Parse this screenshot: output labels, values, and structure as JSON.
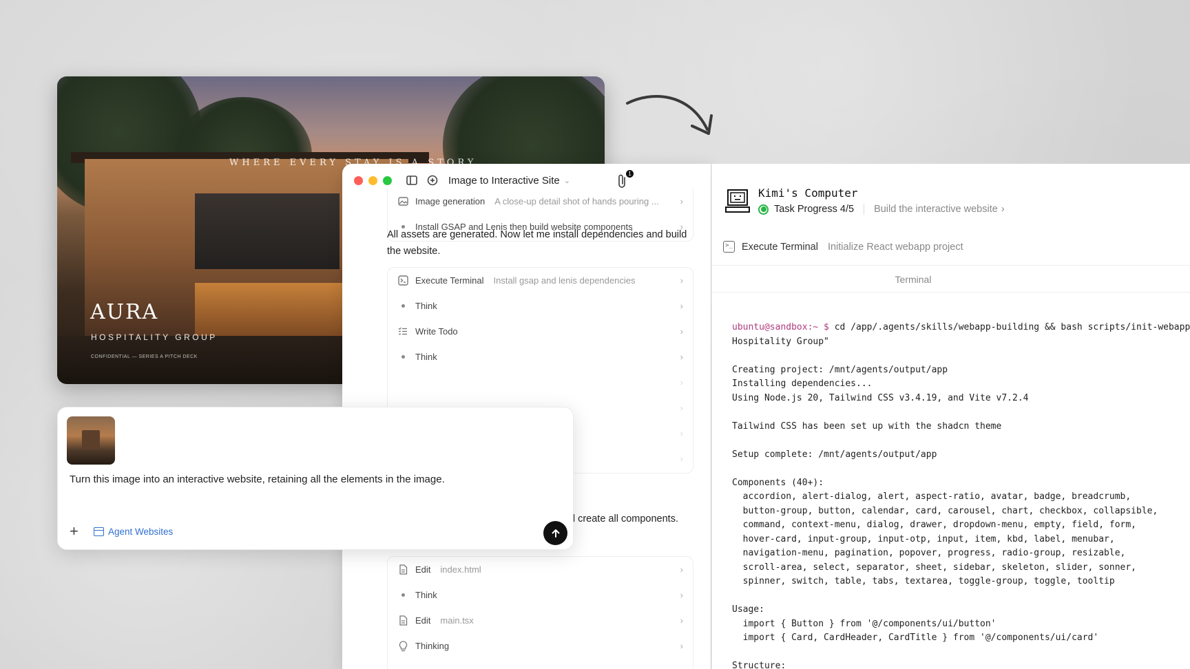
{
  "hero": {
    "tagline": "WHERE EVERY STAY IS A STORY",
    "brand": "AURA",
    "subtitle": "HOSPITALITY GROUP",
    "fine_print": "CONFIDENTIAL — SERIES A PITCH DECK"
  },
  "chat": {
    "title": "Image to Interactive Site",
    "attachment_count": "1",
    "top_steps": [
      {
        "icon": "image-icon",
        "label": "Image generation",
        "desc": "A close-up detail shot of hands pouring ..."
      },
      {
        "icon": "bullet",
        "label": "Install GSAP and Lenis then build website components",
        "desc": ""
      }
    ],
    "message_1": "All assets are generated. Now let me install dependencies and build the website.",
    "middle_steps": [
      {
        "icon": "terminal-icon",
        "label": "Execute Terminal",
        "desc": "Install gsap and lenis dependencies"
      },
      {
        "icon": "bullet",
        "label": "Think",
        "desc": ""
      },
      {
        "icon": "todo-icon",
        "label": "Write Todo",
        "desc": ""
      },
      {
        "icon": "bullet",
        "label": "Think",
        "desc": ""
      }
    ],
    "message_2_visible": "d create all components.",
    "bottom_steps": [
      {
        "icon": "file-icon",
        "label": "Edit",
        "desc": "index.html"
      },
      {
        "icon": "bullet",
        "label": "Think",
        "desc": ""
      },
      {
        "icon": "file-icon",
        "label": "Edit",
        "desc": "main.tsx"
      },
      {
        "icon": "bulb-icon",
        "label": "Thinking",
        "desc": ""
      }
    ]
  },
  "prompt": {
    "text": "Turn this image into an interactive website, retaining all the elements in the image.",
    "agent_tag": "Agent Websites"
  },
  "computer": {
    "title": "Kimi's Computer",
    "progress_label": "Task Progress 4/5",
    "progress_step": "Build the interactive website",
    "exec_label": "Execute Terminal",
    "exec_desc": "Initialize React webapp project",
    "terminal_tab": "Terminal",
    "terminal_prompt": "ubuntu@sandbox:~ $",
    "terminal_command": " cd /app/.agents/skills/webapp-building && bash scripts/init-webapp.sh \"Aura\nHospitality Group\"",
    "terminal_output": "\nCreating project: /mnt/agents/output/app\nInstalling dependencies...\nUsing Node.js 20, Tailwind CSS v3.4.19, and Vite v7.2.4\n\nTailwind CSS has been set up with the shadcn theme\n\nSetup complete: /mnt/agents/output/app\n\nComponents (40+):\n  accordion, alert-dialog, alert, aspect-ratio, avatar, badge, breadcrumb,\n  button-group, button, calendar, card, carousel, chart, checkbox, collapsible,\n  command, context-menu, dialog, drawer, dropdown-menu, empty, field, form,\n  hover-card, input-group, input-otp, input, item, kbd, label, menubar,\n  navigation-menu, pagination, popover, progress, radio-group, resizable,\n  scroll-area, select, separator, sheet, sidebar, skeleton, slider, sonner,\n  spinner, switch, table, tabs, textarea, toggle-group, toggle, tooltip\n\nUsage:\n  import { Button } from '@/components/ui/button'\n  import { Card, CardHeader, CardTitle } from '@/components/ui/card'\n\nStructure:"
  },
  "colors": {
    "accent_blue": "#2f6fd0",
    "progress_green": "#28b446",
    "terminal_user": "#b03a7e"
  }
}
